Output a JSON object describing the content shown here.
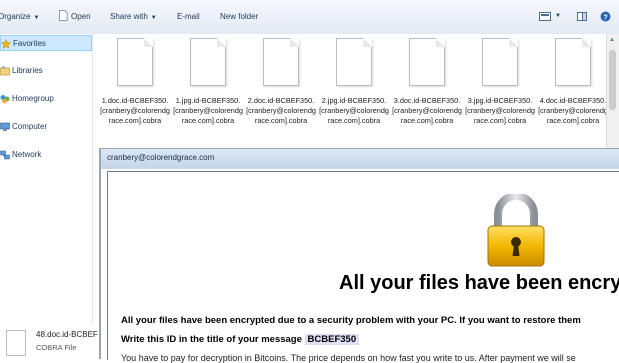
{
  "toolbar": {
    "organize_label": "Organize",
    "open_label": "Open",
    "share_label": "Share with",
    "email_label": "E-mail",
    "newfolder_label": "New folder"
  },
  "sidebar": {
    "items": [
      {
        "label": "Favorites",
        "icon": "star-icon"
      },
      {
        "label": "Libraries",
        "icon": "library-icon"
      },
      {
        "label": "Homegroup",
        "icon": "homegroup-icon"
      },
      {
        "label": "Computer",
        "icon": "computer-icon"
      },
      {
        "label": "Network",
        "icon": "network-icon"
      }
    ]
  },
  "files": [
    {
      "name": "1.doc.id-BCBEF350.[cranbery@colorendgrace.com].cobra"
    },
    {
      "name": "1.jpg.id-BCBEF350.[cranbery@colorendgrace.com].cobra"
    },
    {
      "name": "2.doc.id-BCBEF350.[cranbery@colorendgrace.com].cobra"
    },
    {
      "name": "2.jpg.id-BCBEF350.[cranbery@colorendgrace.com].cobra"
    },
    {
      "name": "3.doc.id-BCBEF350.[cranbery@colorendgrace.com].cobra"
    },
    {
      "name": "3.jpg.id-BCBEF350.[cranbery@colorendgrace.com].cobra"
    },
    {
      "name": "4.doc.id-BCBEF350.[cranbery@colorendgrace.com].cobra"
    }
  ],
  "ransom": {
    "window_title": "cranbery@colorendgrace.com",
    "headline": "All your files have been encry",
    "line1": "All your files have been encrypted due to a security problem with your PC. If you want to restore them",
    "line2_prefix": "Write this ID in the title of your message",
    "id": "BCBEF350",
    "line3": "You have to pay for decryption in Bitcoins. The price depends on how fast you write to us. After payment we will se"
  },
  "status": {
    "filename": "48.doc.id-BCBEF",
    "filetype": "COBRA File"
  },
  "colors": {
    "lock_body": "#f2b700",
    "lock_shackle": "#b8bcc2",
    "selection": "#cde8ff"
  }
}
